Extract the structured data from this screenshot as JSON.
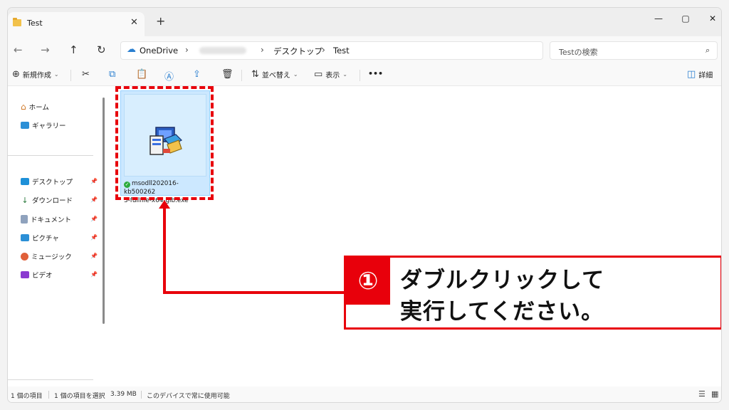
{
  "window": {
    "tab_title": "Test",
    "tab_close": "✕",
    "new_tab": "+",
    "minimize": "—",
    "maximize": "▢",
    "close": "✕"
  },
  "nav": {
    "back": "←",
    "forward": "→",
    "up": "↑",
    "refresh": "↻"
  },
  "address": {
    "cloud_icon": "☁",
    "crumbs": [
      "OneDrive",
      "デスクトップ",
      "Test"
    ],
    "separator": "›"
  },
  "search": {
    "placeholder": "Testの検索",
    "icon": "⌕"
  },
  "toolbar": {
    "new_label": "新規作成",
    "sort_label": "並べ替え",
    "view_label": "表示",
    "more": "•••",
    "details_label": "詳細",
    "icons": {
      "new": "⊕",
      "cut": "✂",
      "copy": "⧉",
      "paste": "📋",
      "rename": "Ⓐ",
      "share": "⇪",
      "delete": "🗑",
      "sort": "⇅",
      "view": "▭",
      "details": "◫"
    }
  },
  "sidebar": {
    "top_items": [
      {
        "label": "ホーム",
        "icon": "home-icon"
      },
      {
        "label": "ギャラリー",
        "icon": "gallery-icon"
      }
    ],
    "pinned_items": [
      {
        "label": "デスクトップ",
        "icon": "desktop-icon",
        "color": "#1e90d8"
      },
      {
        "label": "ダウンロード",
        "icon": "download-icon",
        "color": "#2c7a3d"
      },
      {
        "label": "ドキュメント",
        "icon": "document-icon",
        "color": "#5a6c8a"
      },
      {
        "label": "ピクチャ",
        "icon": "picture-icon",
        "color": "#2b8fd6"
      },
      {
        "label": "ミュージック",
        "icon": "music-icon",
        "color": "#e0603a"
      },
      {
        "label": "ビデオ",
        "icon": "video-icon",
        "color": "#8a3ad0"
      }
    ],
    "pin_glyph": "📌"
  },
  "file": {
    "name_line1": "msodll202016-kb500262",
    "name_line2": "3-fullfile-x64-glb.exe",
    "sync_check": "✓"
  },
  "callout": {
    "number": "①",
    "line1": "ダブルクリックして",
    "line2": "実行してください。"
  },
  "status": {
    "item_count": "1 個の項目",
    "selected": "1 個の項目を選択",
    "size": "3.39 MB",
    "availability": "このデバイスで常に使用可能",
    "list_view_icon": "☰",
    "tile_view_icon": "▦"
  },
  "colors": {
    "accent_red": "#e8000b",
    "selection": "#cce8ff"
  }
}
